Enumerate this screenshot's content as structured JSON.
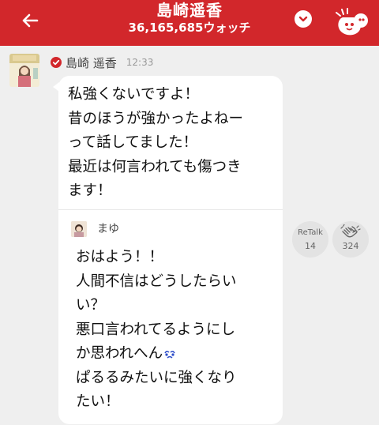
{
  "header": {
    "title": "島崎遥香",
    "watch_count": "36,165,685ウォッチ",
    "back_icon": "arrow-left-icon",
    "dropdown_icon": "chevron-down-icon",
    "mascot_icon": "mascot-icon"
  },
  "message": {
    "sender": "島崎 遥香",
    "time": "12:33",
    "verified_icon": "verified-badge-icon",
    "text": "私強くないですよ！\n昔のほうが強かったよねー\nって話してました！\n最近は何言われても傷つき\nます！",
    "quote": {
      "sender": "まゆ",
      "text": "おはよう！！\n人間不信はどうしたらい\nい？\n悪口言われてるようにし\nか思われへん",
      "emoji": "crying-face-emoji",
      "text_after": "\nぱるるみたいに強くなり\nたい！"
    }
  },
  "actions": {
    "retalk": {
      "label": "ReTalk",
      "count": "14"
    },
    "clap": {
      "icon": "clap-icon",
      "count": "324"
    }
  },
  "colors": {
    "header_bg": "#d2272b",
    "page_bg": "#efefef",
    "bubble_bg": "#ffffff",
    "button_bg": "#e3e3e3"
  }
}
